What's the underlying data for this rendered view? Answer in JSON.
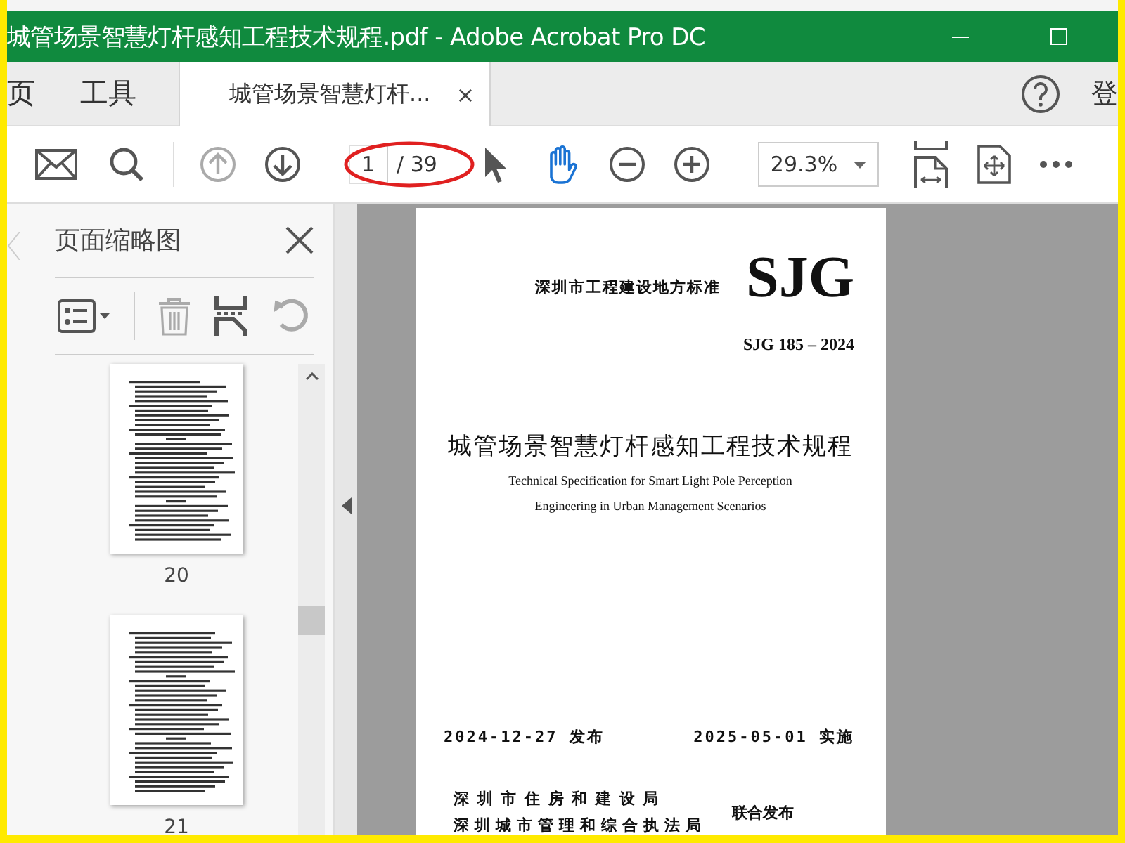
{
  "window": {
    "title": "城管场景智慧灯杆感知工程技术规程.pdf - Adobe Acrobat Pro DC"
  },
  "tabs": [
    {
      "label": "页",
      "selected": false
    },
    {
      "label": "工具",
      "selected": false
    },
    {
      "label": "城管场景智慧灯杆...",
      "selected": true,
      "close": "×"
    }
  ],
  "account_label": "登",
  "toolbar": {
    "previous_page": {
      "disabled": true
    },
    "next_page": {
      "disabled": false
    },
    "page_field": {
      "value": "1"
    },
    "page_total": "/ 39",
    "select_tool": {
      "selected": false
    },
    "hand_tool": {
      "selected": true
    },
    "zoom": {
      "value": "29.3%"
    }
  },
  "thumbnail_panel": {
    "title": "页面缩略图",
    "delete": {
      "disabled": true
    },
    "rotate": {
      "disabled": true
    },
    "thumbnails": [
      {
        "label": "20"
      },
      {
        "label": "21"
      }
    ]
  },
  "document": {
    "series_label": "深圳市工程建设地方标准",
    "logo": "SJG",
    "code": "SJG 185 – 2024",
    "title": "城管场景智慧灯杆感知工程技术规程",
    "subtitle": [
      "Technical Specification for Smart Light Pole Perception",
      "Engineering in Urban Management Scenarios"
    ],
    "issue_date": "2024-12-27 发布",
    "effective_date": "2025-05-01 实施",
    "issuers": [
      "深 圳 市 住 房 和 建 设 局",
      "深圳城市管理和综合执法局"
    ],
    "joint_issue": "联合发布"
  }
}
